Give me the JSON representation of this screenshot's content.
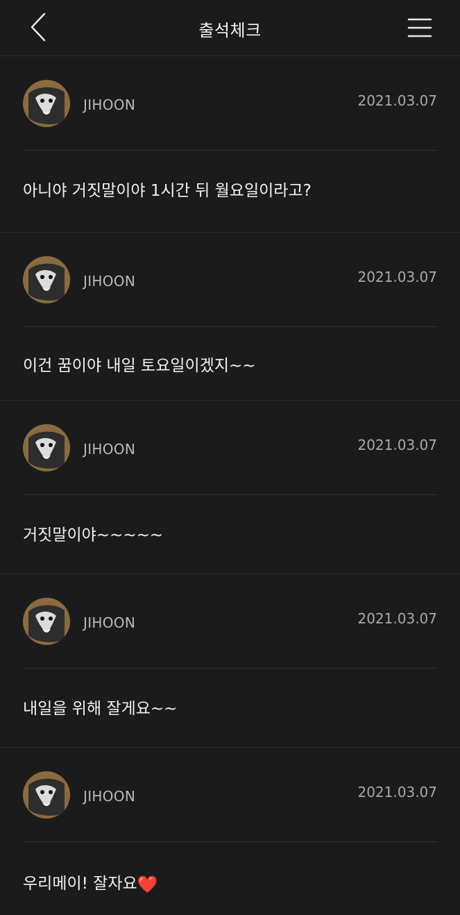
{
  "header": {
    "title": "출석체크"
  },
  "posts": [
    {
      "author": "JIHOON",
      "date": "2021.03.07",
      "text": "아니야 거짓말이야 1시간 뒤 월요일이라고?"
    },
    {
      "author": "JIHOON",
      "date": "2021.03.07",
      "text": "이건 꿈이야 내일 토요일이겠지~~"
    },
    {
      "author": "JIHOON",
      "date": "2021.03.07",
      "text": "거짓말이야~~~~~"
    },
    {
      "author": "JIHOON",
      "date": "2021.03.07",
      "text": "내일을 위해 잘게요~~"
    },
    {
      "author": "JIHOON",
      "date": "2021.03.07",
      "text": "우리메이! 잘자요",
      "emoji": "❤️"
    }
  ],
  "colors": {
    "background": "#1b1b1b",
    "divider": "#2c2c2c",
    "text_primary": "#f1f1f1",
    "text_secondary": "#a9a9a9",
    "heart": "#ff5a7a"
  },
  "icons": {
    "back": "chevron-left-icon",
    "menu": "hamburger-menu-icon",
    "avatar": "dog-avatar",
    "heart": "heart-icon"
  }
}
